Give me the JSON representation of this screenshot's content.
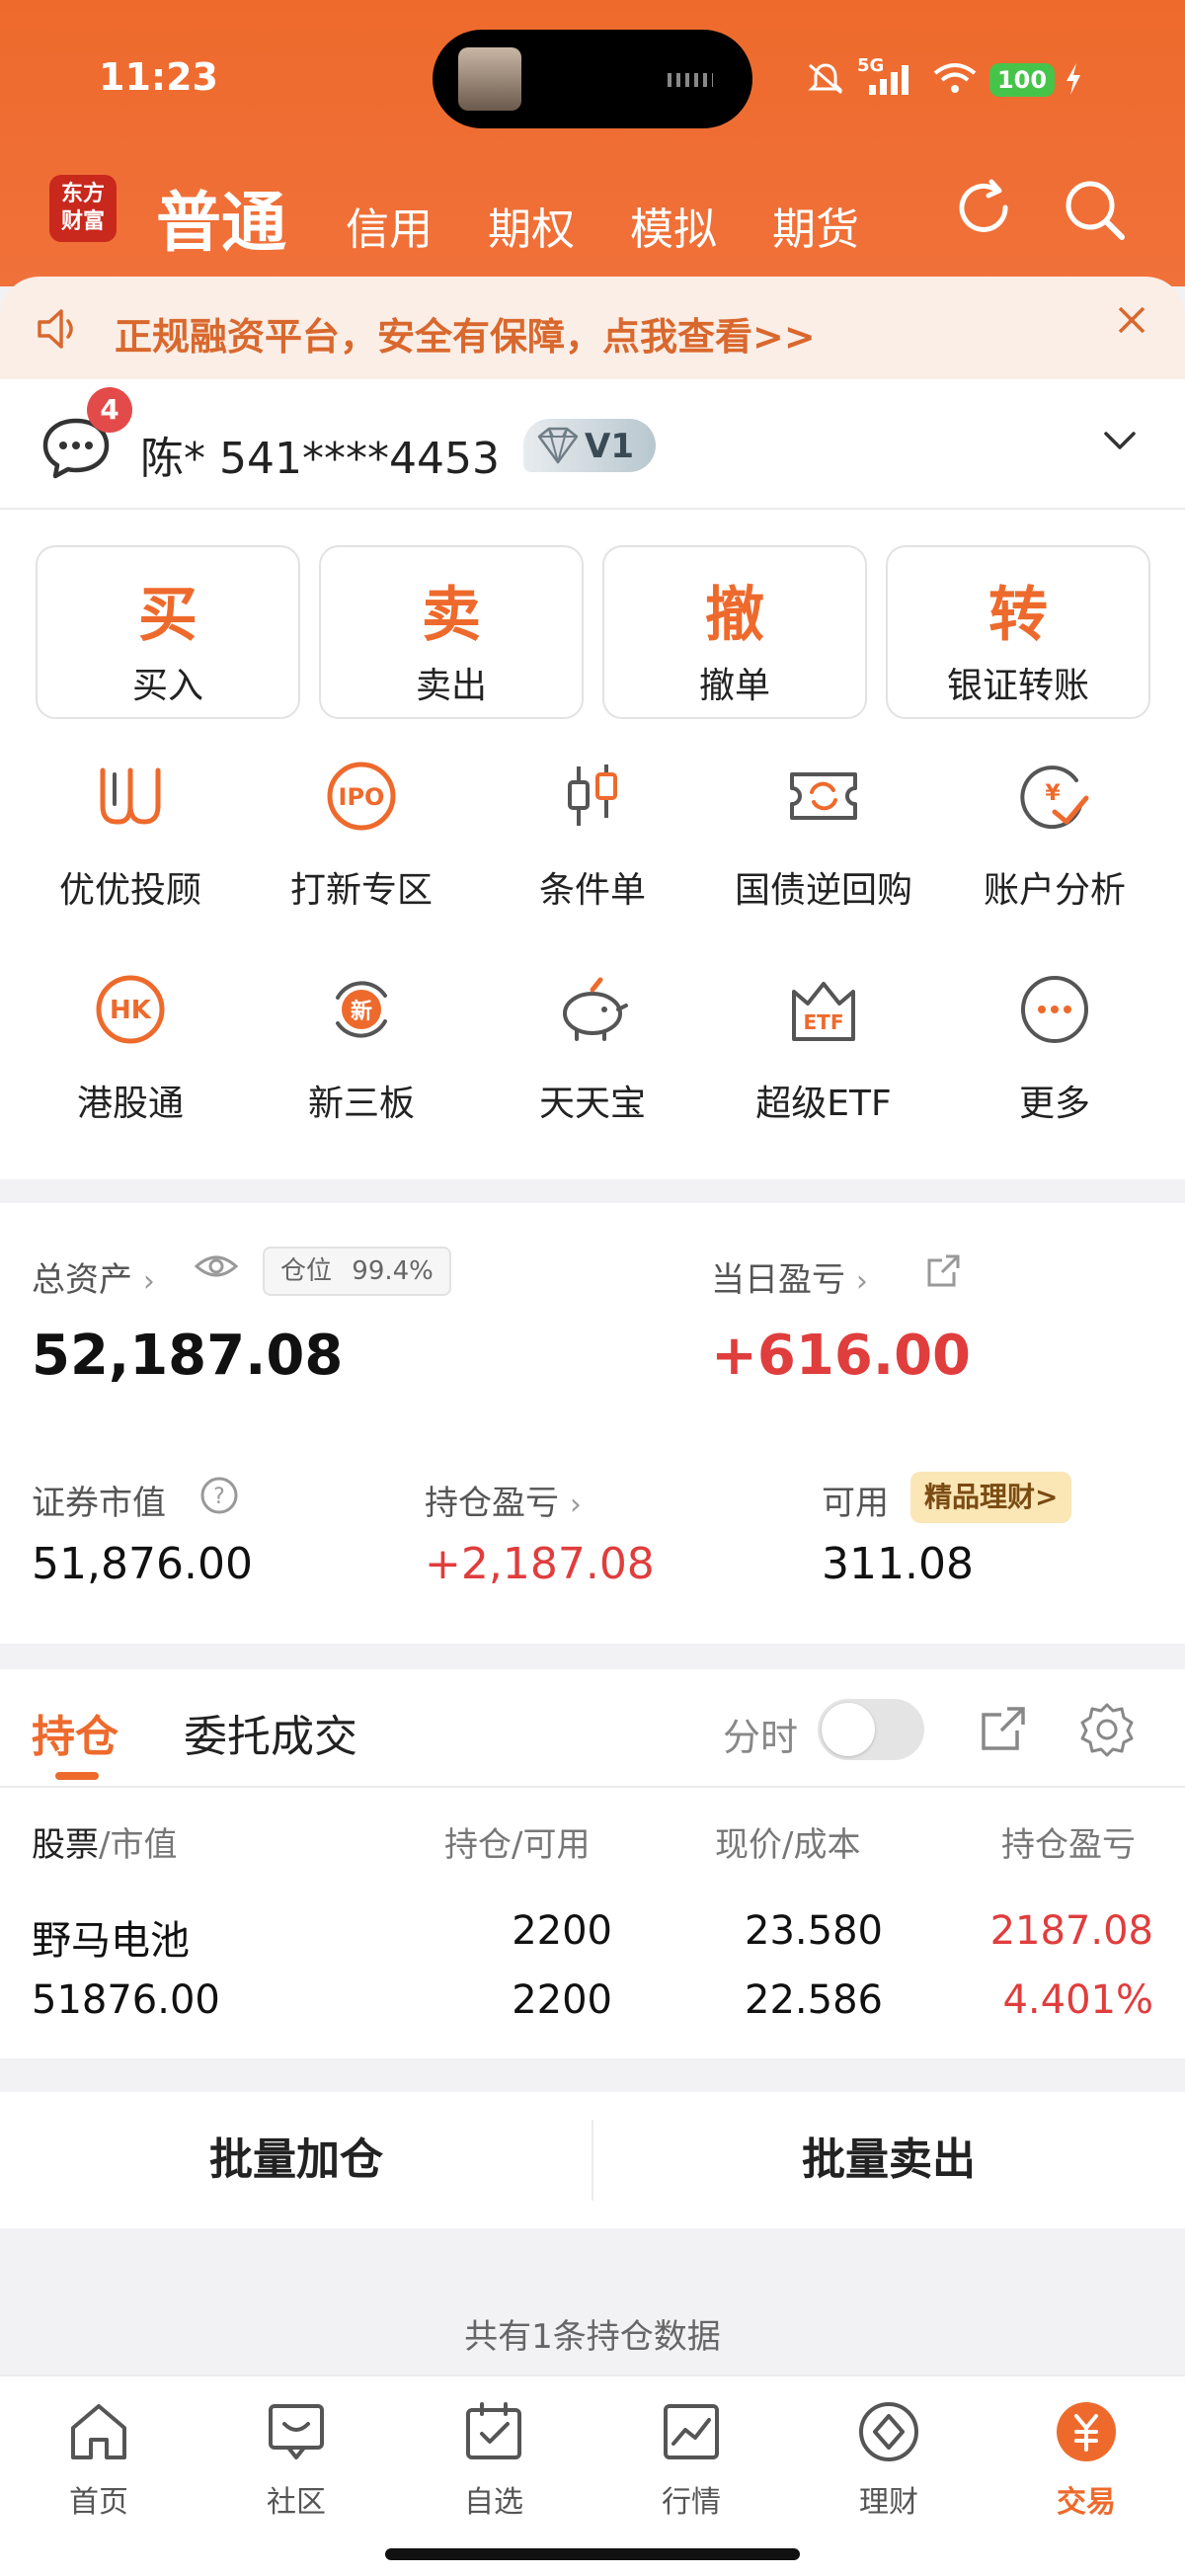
{
  "status_bar": {
    "time": "11:23",
    "network": "5G",
    "battery": "100"
  },
  "header": {
    "logo": [
      "东方",
      "财富"
    ],
    "tabs": [
      {
        "label": "普通",
        "active": true
      },
      {
        "label": "信用"
      },
      {
        "label": "期权"
      },
      {
        "label": "模拟"
      },
      {
        "label": "期货"
      }
    ]
  },
  "banner": {
    "text": "正规融资平台，安全有保障，点我查看>>"
  },
  "account": {
    "message_count": "4",
    "display": "陈* 541****4453",
    "vip_level": "V1"
  },
  "trade_buttons": [
    {
      "char": "买",
      "label": "买入"
    },
    {
      "char": "卖",
      "label": "卖出"
    },
    {
      "char": "撤",
      "label": "撤单"
    },
    {
      "char": "转",
      "label": "银证转账"
    }
  ],
  "tools": [
    {
      "label": "优优投顾",
      "icon": "uu-icon"
    },
    {
      "label": "打新专区",
      "icon": "ipo-icon"
    },
    {
      "label": "条件单",
      "icon": "candlestick-icon"
    },
    {
      "label": "国债逆回购",
      "icon": "ticket-cycle-icon"
    },
    {
      "label": "账户分析",
      "icon": "yen-check-icon"
    },
    {
      "label": "港股通",
      "icon": "hk-icon"
    },
    {
      "label": "新三板",
      "icon": "new-cycle-icon"
    },
    {
      "label": "天天宝",
      "icon": "piggy-bank-icon"
    },
    {
      "label": "超级ETF",
      "icon": "etf-crown-icon"
    },
    {
      "label": "更多",
      "icon": "more-icon"
    }
  ],
  "assets": {
    "total_label": "总资产",
    "position_ratio_label": "仓位",
    "position_ratio": "99.4%",
    "total_value": "52,187.08",
    "daily_pnl_label": "当日盈亏",
    "daily_pnl": "+616.00",
    "market_value_label": "证券市值",
    "market_value": "51,876.00",
    "holding_pnl_label": "持仓盈亏",
    "holding_pnl": "+2,187.08",
    "available_label": "可用",
    "available": "311.08",
    "promo": "精品理财>"
  },
  "positions": {
    "tabs": [
      "持仓",
      "委托成交"
    ],
    "timeshare_label": "分时",
    "headers": {
      "stock_a": "股票",
      "stock_b": "/市值",
      "qty": "持仓/可用",
      "price": "现价/成本",
      "pnl": "持仓盈亏"
    },
    "rows": [
      {
        "name": "野马电池",
        "market_value": "51876.00",
        "holding": "2200",
        "available": "2200",
        "price": "23.580",
        "cost": "22.586",
        "pnl": "2187.08",
        "pnl_pct": "4.401%"
      }
    ]
  },
  "batch": {
    "add": "批量加仓",
    "sell": "批量卖出"
  },
  "summary_text": "共有1条持仓数据",
  "bottom_nav": [
    {
      "label": "首页",
      "icon": "home-icon"
    },
    {
      "label": "社区",
      "icon": "community-icon"
    },
    {
      "label": "自选",
      "icon": "watchlist-icon"
    },
    {
      "label": "行情",
      "icon": "market-chart-icon"
    },
    {
      "label": "理财",
      "icon": "wealth-diamond-icon"
    },
    {
      "label": "交易",
      "icon": "trade-yen-icon",
      "active": true
    }
  ],
  "colors": {
    "brand_orange": "#ee6a2c",
    "profit_red": "#e03d3d"
  }
}
